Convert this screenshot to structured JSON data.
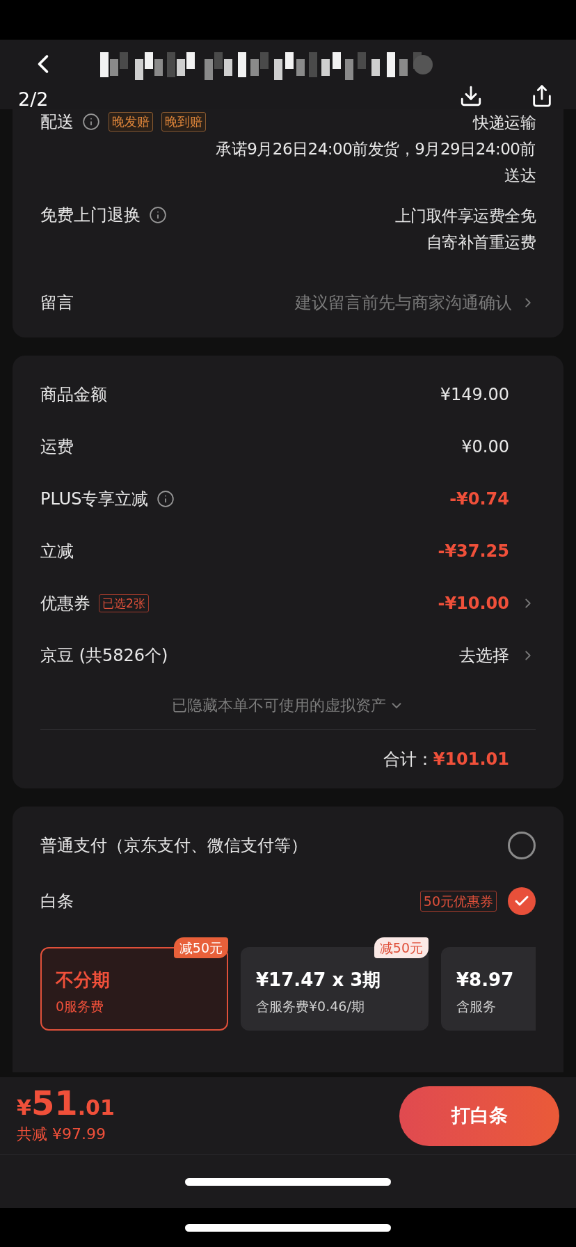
{
  "header": {
    "page_indicator": "2/2"
  },
  "delivery_card": {
    "rows": [
      {
        "kind": "delivery",
        "label": "配送",
        "info": true,
        "tags": [
          "晚发赔",
          "晚到赔"
        ],
        "lines": [
          "快递运输",
          "承诺9月26日24:00前发货，9月29日24:00前",
          "送达"
        ]
      },
      {
        "kind": "delivery",
        "label": "免费上门退换",
        "info": true,
        "lines": [
          "上门取件享运费全免",
          "自寄补首重运费"
        ]
      },
      {
        "kind": "input",
        "label": "留言",
        "placeholder": "建议留言前先与商家沟通确认"
      }
    ]
  },
  "price_card": {
    "rows": [
      {
        "label": "商品金额",
        "value": "¥149.00",
        "discount": false
      },
      {
        "label": "运费",
        "value": "¥0.00",
        "discount": false
      },
      {
        "label": "PLUS专享立减",
        "value": "-¥0.74",
        "discount": true,
        "info": true
      },
      {
        "label": "立减",
        "value": "-¥37.25",
        "discount": true
      },
      {
        "label": "优惠券",
        "badge": "已选2张",
        "value": "-¥10.00",
        "discount": true,
        "chevron": true
      },
      {
        "label": "京豆 (共5826个)",
        "value": "去选择",
        "discount": false,
        "chevron": true
      }
    ],
    "hidden_assets": {
      "label": "已隐藏本单不可使用的虚拟资产",
      "expanded": false
    },
    "total_label": "合计：",
    "total_value": "¥101.01"
  },
  "payment_card": {
    "options": [
      {
        "label": "普通支付（京东支付、微信支付等）",
        "selected": false
      },
      {
        "label": "白条",
        "badge": "50元优惠券",
        "selected": true
      }
    ],
    "plans": [
      {
        "title": "不分期",
        "subtitle": "0服务费",
        "tag": "减50元",
        "selected": true
      },
      {
        "title": "¥17.47 x 3期",
        "subtitle": "含服务费¥0.46/期",
        "tag": "减50元",
        "selected": false
      },
      {
        "title": "¥8.97",
        "subtitle": "含服务",
        "selected": false
      }
    ]
  },
  "bottom_bar": {
    "currency": "¥",
    "price_integer": "51",
    "price_decimal": ".01",
    "savings": "共减 ¥97.99",
    "button": "打白条"
  }
}
